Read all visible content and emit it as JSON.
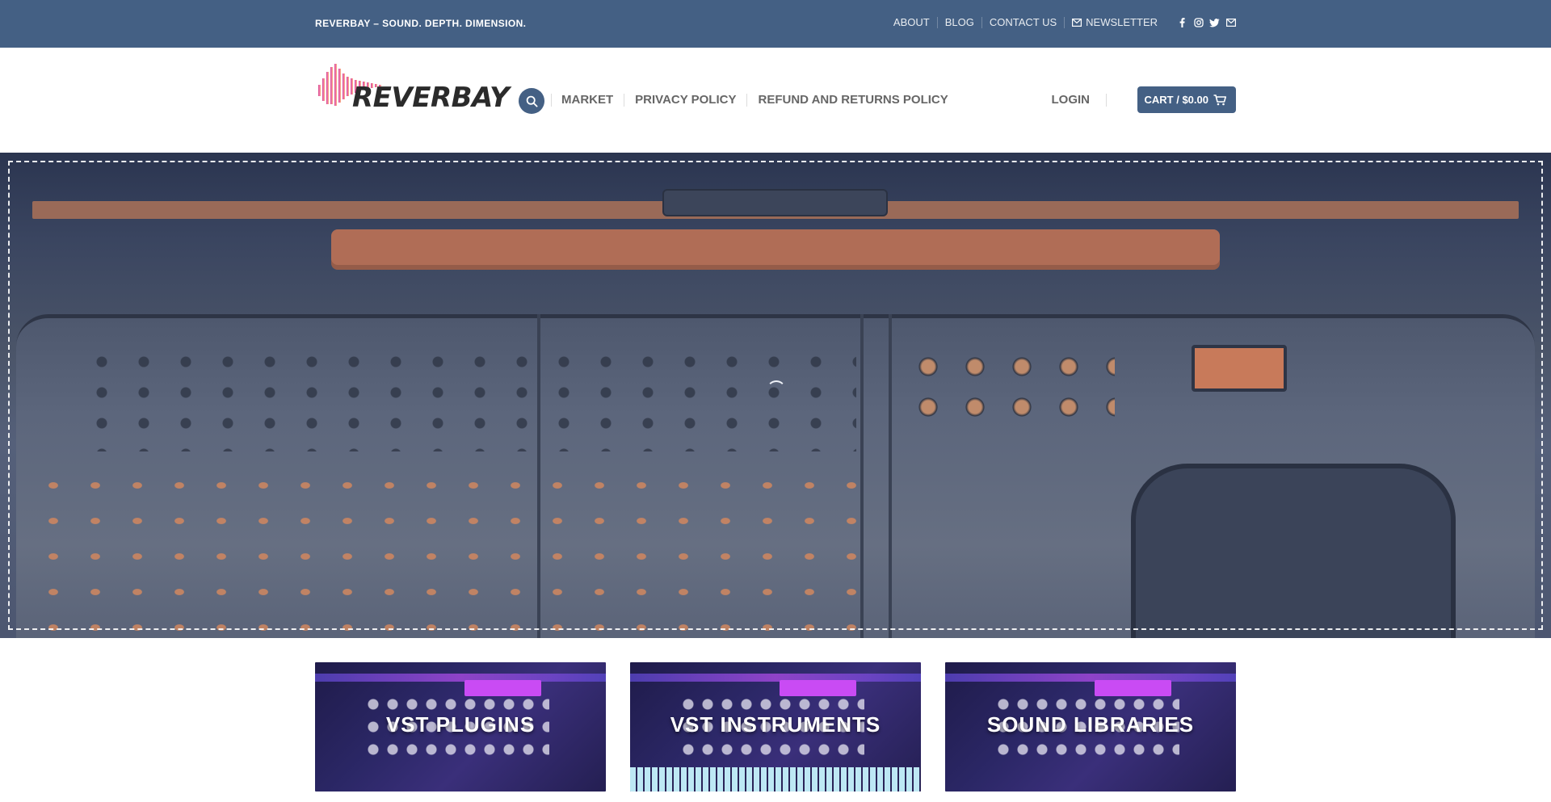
{
  "topbar": {
    "tagline": "REVERBAY – SOUND. DEPTH. DIMENSION.",
    "links": [
      "ABOUT",
      "BLOG",
      "CONTACT US"
    ],
    "newsletter": "NEWSLETTER",
    "social_icons": [
      "facebook-icon",
      "instagram-icon",
      "twitter-icon",
      "mail-icon"
    ]
  },
  "header": {
    "logo_text": "REVERBAY",
    "nav": [
      "MARKET",
      "PRIVACY POLICY",
      "REFUND AND RETURNS POLICY"
    ],
    "login": "LOGIN",
    "cart": "CART / $0.00"
  },
  "categories": [
    {
      "label": "VST PLUGINS"
    },
    {
      "label": "VST INSTRUMENTS"
    },
    {
      "label": "SOUND LIBRARIES"
    }
  ],
  "colors": {
    "primary": "#446084",
    "accent_pink": "#e0509a",
    "card_purple": "#2b2766"
  }
}
